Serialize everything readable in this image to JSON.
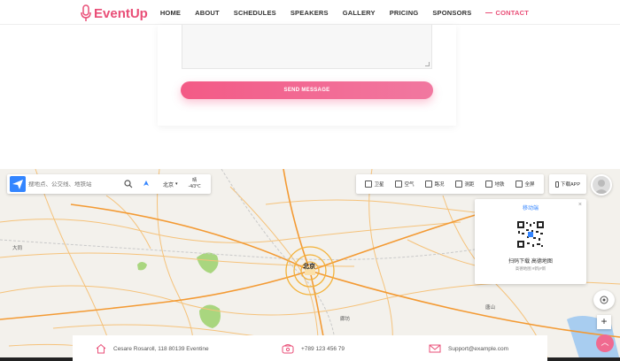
{
  "header": {
    "logo_text": "EventUp",
    "nav": [
      {
        "label": "HOME"
      },
      {
        "label": "ABOUT"
      },
      {
        "label": "SCHEDULES"
      },
      {
        "label": "SPEAKERS"
      },
      {
        "label": "GALLERY"
      },
      {
        "label": "PRICING"
      },
      {
        "label": "SPONSORS"
      },
      {
        "label": "CONTACT",
        "active": true
      }
    ]
  },
  "form": {
    "send_label": "SEND MESSAGE"
  },
  "map": {
    "search_placeholder": "搜地点、公交线、地铁站",
    "city": "北京",
    "weather_line1": "晴",
    "weather_line2": "-4/3℃",
    "tools": [
      {
        "label": "卫星",
        "icon": "satellite-icon"
      },
      {
        "label": "空气",
        "icon": "air-icon"
      },
      {
        "label": "路况",
        "icon": "traffic-icon"
      },
      {
        "label": "测距",
        "icon": "ruler-icon"
      },
      {
        "label": "地铁",
        "icon": "subway-icon"
      },
      {
        "label": "全屏",
        "icon": "fullscreen-icon"
      }
    ],
    "download_label": "下载APP",
    "qr": {
      "title": "移动端",
      "close": "×",
      "text": "扫码下载 高德地图",
      "sub": "高德地图 #新|#新"
    },
    "labels": [
      {
        "text": "北京"
      },
      {
        "text": "廊坊"
      },
      {
        "text": "大同"
      },
      {
        "text": "唐山"
      }
    ],
    "zoom_plus": "+",
    "scroll_top_icon": "chevron-up-icon",
    "colors": {
      "road": "#f5b561",
      "highway": "#f39a33",
      "park": "#a9d67f",
      "water": "#a8cdf0"
    }
  },
  "contact": {
    "address": "Cesare Rosaroll, 118 80139 Eventine",
    "phone": "+789 123 456 79",
    "email": "Support@example.com"
  },
  "colors": {
    "accent": "#e94e77"
  }
}
